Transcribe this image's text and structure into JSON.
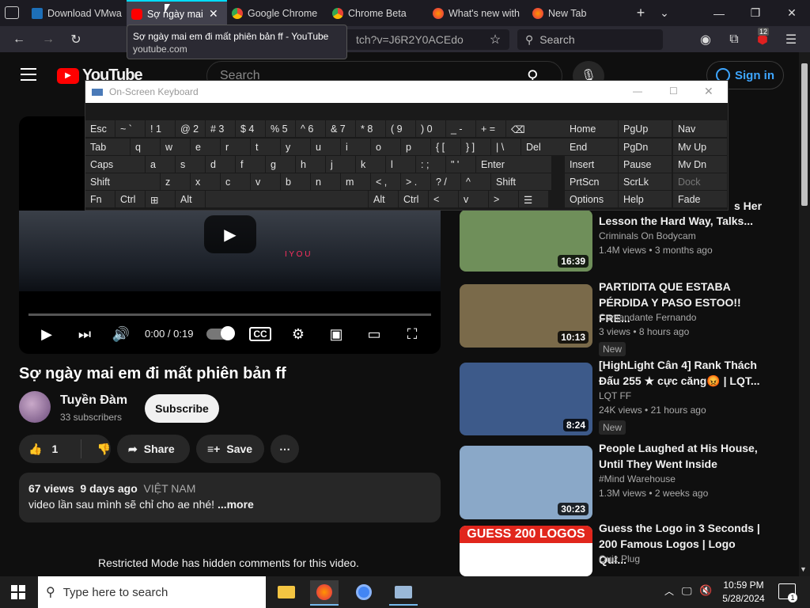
{
  "browser": {
    "tabs": [
      {
        "label": "Download VMwa",
        "active": false
      },
      {
        "label": "Sợ ngày mai",
        "active": true
      },
      {
        "label": "Google Chrome",
        "active": false
      },
      {
        "label": "Chrome Beta",
        "active": false
      },
      {
        "label": "What's new with",
        "active": false
      },
      {
        "label": "New Tab",
        "active": false
      }
    ],
    "url_fragment": "tch?v=J6R2Y0ACEdo",
    "search_placeholder": "Search",
    "extension_badge": "12",
    "tooltip": {
      "title": "Sợ ngày mai em đi mất phiên bản ff - YouTube",
      "url": "youtube.com"
    }
  },
  "youtube": {
    "logo": "YouTube",
    "search_placeholder": "Search",
    "signin_label": "Sign in"
  },
  "osk": {
    "title": "On-Screen Keyboard",
    "rows": [
      [
        "Esc",
        "~ `",
        "! 1",
        "@ 2",
        "# 3",
        "$ 4",
        "% 5",
        "^ 6",
        "& 7",
        "* 8",
        "( 9",
        ") 0",
        "_ -",
        "+ =",
        "⌫"
      ],
      [
        "Tab",
        "q",
        "w",
        "e",
        "r",
        "t",
        "y",
        "u",
        "i",
        "o",
        "p",
        "{ [",
        "} ]",
        "| \\",
        "Del"
      ],
      [
        "Caps",
        "a",
        "s",
        "d",
        "f",
        "g",
        "h",
        "j",
        "k",
        "l",
        ": ;",
        "\" '",
        "Enter"
      ],
      [
        "Shift",
        "z",
        "x",
        "c",
        "v",
        "b",
        "n",
        "m",
        "< ,",
        "> .",
        "? /",
        "^",
        "Shift"
      ],
      [
        "Fn",
        "Ctrl",
        "⊞",
        "Alt",
        "",
        "Alt",
        "Ctrl",
        "<",
        "v",
        ">",
        "☰"
      ]
    ],
    "nav": [
      [
        "Home",
        "PgUp",
        "Nav"
      ],
      [
        "End",
        "PgDn",
        "Mv Up"
      ],
      [
        "Insert",
        "Pause",
        "Mv Dn"
      ],
      [
        "PrtScn",
        "ScrLk",
        "Dock"
      ],
      [
        "Options",
        "Help",
        "Fade"
      ]
    ]
  },
  "video": {
    "time": "0:00 / 0:19",
    "title": "Sợ ngày mai em đi mất phiên bản ff",
    "channel": "Tuyền Đàm",
    "subscribers": "33 subscribers",
    "subscribe_label": "Subscribe",
    "likes": "1",
    "share_label": "Share",
    "save_label": "Save",
    "views": "67 views",
    "age": "9 days ago",
    "country": "VIỆT NAM",
    "description": "video lần sau mình sẽ chỉ cho ae nhé!",
    "more_label": "...more",
    "overlay_text": "I Y O U",
    "restricted_notice": "Restricted Mode has hidden comments for this video."
  },
  "sidebar": {
    "partial_top_title": "s Her",
    "items": [
      {
        "title_line1": "Lesson the Hard Way, Talks...",
        "title_line2": "",
        "channel": "Criminals On Bodycam",
        "views": "1.4M views",
        "age": "3 months ago",
        "duration": "16:39",
        "badge": "",
        "thumb_color": "#6f8f5a"
      },
      {
        "title_line1": "PARTIDITA QUE ESTABA",
        "title_line2": "PÉRDIDA Y PASO ESTOO!! FRE...",
        "channel": "Comandante Fernando",
        "views": "3 views",
        "age": "8 hours ago",
        "duration": "10:13",
        "badge": "New",
        "thumb_color": "#7a6a4a"
      },
      {
        "title_line1": "[HighLight Cân 4] Rank Thách",
        "title_line2": "Đấu 255 ★ cực căng😡 | LQT...",
        "channel": "LQT FF",
        "views": "24K views",
        "age": "21 hours ago",
        "duration": "8:24",
        "badge": "New",
        "thumb_color": "#3d5a8a"
      },
      {
        "title_line1": "People Laughed at His House,",
        "title_line2": "Until They Went Inside",
        "channel": "#Mind Warehouse",
        "views": "1.3M views",
        "age": "2 weeks ago",
        "duration": "30:23",
        "badge": "",
        "thumb_color": "#8aa8c8"
      },
      {
        "title_line1": "Guess the Logo in 3 Seconds |",
        "title_line2": "200 Famous Logos | Logo Qui...",
        "channel": "Quiz Plug",
        "views": "",
        "age": "",
        "duration": "",
        "badge": "",
        "thumb_color": "#ffffff",
        "thumb_text": "GUESS 200 LOGOS"
      }
    ]
  },
  "taskbar": {
    "search_placeholder": "Type here to search",
    "time": "10:59 PM",
    "date": "5/28/2024",
    "notification_count": "1"
  }
}
